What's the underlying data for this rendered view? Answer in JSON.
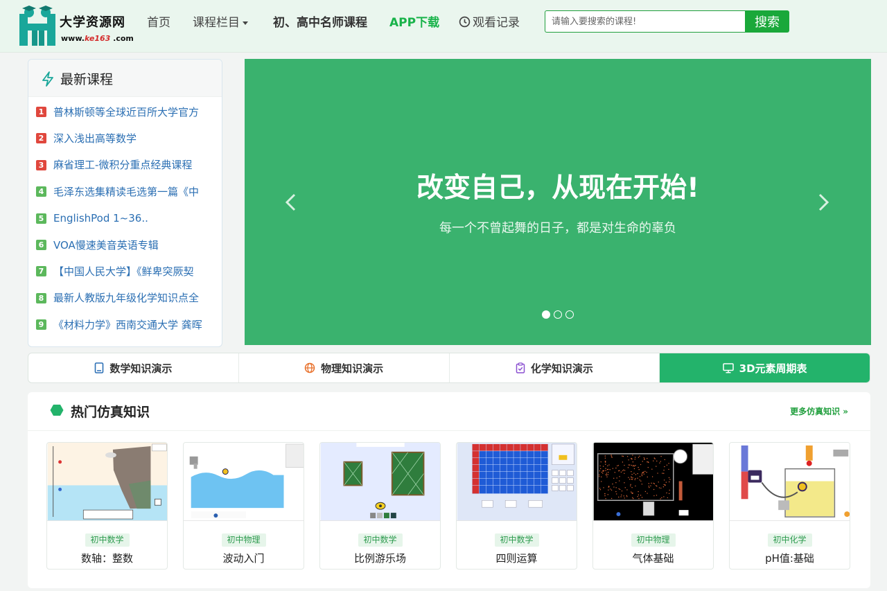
{
  "header": {
    "logo_title": "大学资源网",
    "logo_url_prefix": "www.",
    "logo_url_brand": "ke163",
    "logo_url_suffix": " .com",
    "nav": {
      "home": "首页",
      "columns": "课程栏目",
      "teachers": "初、高中名师课程",
      "app": "APP下载",
      "history": "观看记录"
    },
    "search_placeholder": "请输入要搜索的课程!",
    "search_button": "搜索"
  },
  "latest": {
    "title": "最新课程",
    "items": [
      {
        "rank": "1",
        "text": "普林斯顿等全球近百所大学官方"
      },
      {
        "rank": "2",
        "text": "深入浅出高等数学"
      },
      {
        "rank": "3",
        "text": "麻省理工-微积分重点经典课程"
      },
      {
        "rank": "4",
        "text": "毛泽东选集精读毛选第一篇《中"
      },
      {
        "rank": "5",
        "text": "EnglishPod 1~36.."
      },
      {
        "rank": "6",
        "text": "VOA慢速美音英语专辑"
      },
      {
        "rank": "7",
        "text": "【中国人民大学】《鲜卑突厥契"
      },
      {
        "rank": "8",
        "text": "最新人教版九年级化学知识点全"
      },
      {
        "rank": "9",
        "text": "《材料力学》西南交通大学 龚晖"
      }
    ]
  },
  "banner": {
    "title": "改变自己，从现在开始!",
    "subtitle": "每一个不曾起舞的日子，都是对生命的辜负"
  },
  "tabs": [
    {
      "label": "数学知识演示"
    },
    {
      "label": "物理知识演示"
    },
    {
      "label": "化学知识演示"
    },
    {
      "label": "3D元素周期表"
    }
  ],
  "hot": {
    "title": "热门仿真知识",
    "more": "更多仿真知识 »",
    "cards": [
      {
        "tag": "初中数学",
        "name": "数轴：整数"
      },
      {
        "tag": "初中物理",
        "name": "波动入门"
      },
      {
        "tag": "初中数学",
        "name": "比例游乐场"
      },
      {
        "tag": "初中数学",
        "name": "四则运算"
      },
      {
        "tag": "初中物理",
        "name": "气体基础"
      },
      {
        "tag": "初中化学",
        "name": "pH值:基础"
      }
    ]
  },
  "colors": {
    "header_bg": "#eaf6ee",
    "banner_bg": "#3ab26e",
    "accent_green": "#1aa83a",
    "active_tab": "#23b36b",
    "link_blue": "#2b6fb3",
    "rank_red": "#e0473d",
    "rank_green": "#5cb85c"
  },
  "icons": {
    "latest": "lightning-icon",
    "history": "clock-icon",
    "math_tab": "tablet-icon",
    "physics_tab": "globe-icon",
    "chemistry_tab": "clipboard-check-icon",
    "periodic_tab": "monitor-icon",
    "hot": "hexagon-icon"
  }
}
